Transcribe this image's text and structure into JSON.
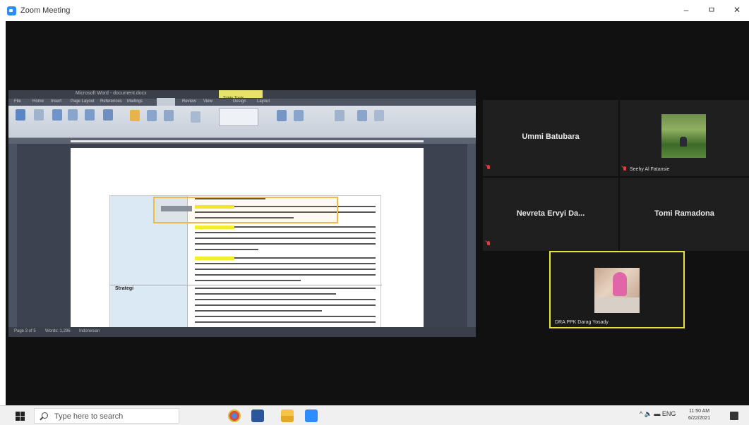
{
  "window": {
    "title": "Zoom Meeting",
    "minimize": "–",
    "maximize": "ㅁ",
    "close": "✕"
  },
  "shared_document": {
    "app_title": "Microsoft Word - document.docx",
    "active_tab": "Table Tools",
    "menu": [
      "File",
      "Home",
      "Insert",
      "Page Layout",
      "References",
      "Mailings",
      "Review",
      "View",
      "Design",
      "Layout"
    ],
    "table_row_label": "Strategi",
    "status_left": "Page 3 of 5",
    "status_words": "Words: 1,296",
    "status_lang": "Indonesian"
  },
  "participants": [
    {
      "name": "Ummi Batubara",
      "muted": true
    },
    {
      "name": "Seehy Al Fatansie",
      "muted": true,
      "has_video": true
    },
    {
      "name": "Nevreta Ervyi Da...",
      "muted": true
    },
    {
      "name": "Tomi Ramadona",
      "muted": false
    },
    {
      "name": "DRA PPK Darag Yosady",
      "muted": false,
      "speaking": true,
      "has_video": true
    }
  ],
  "taskbar": {
    "search_placeholder": "Type here to search",
    "apps": [
      "chrome-icon",
      "word-icon",
      "file-explorer-icon",
      "zoom-icon"
    ],
    "tray": "^ 🔈 ▬ ENG",
    "time": "11:50 AM",
    "date": "6/22/2021"
  },
  "colors": {
    "meeting_bg": "#111111",
    "tile_bg": "#1f1f1f",
    "speaker_border": "#e4e63a",
    "muted_mic": "#e03c3c",
    "zoom_blue": "#2d8cff"
  }
}
